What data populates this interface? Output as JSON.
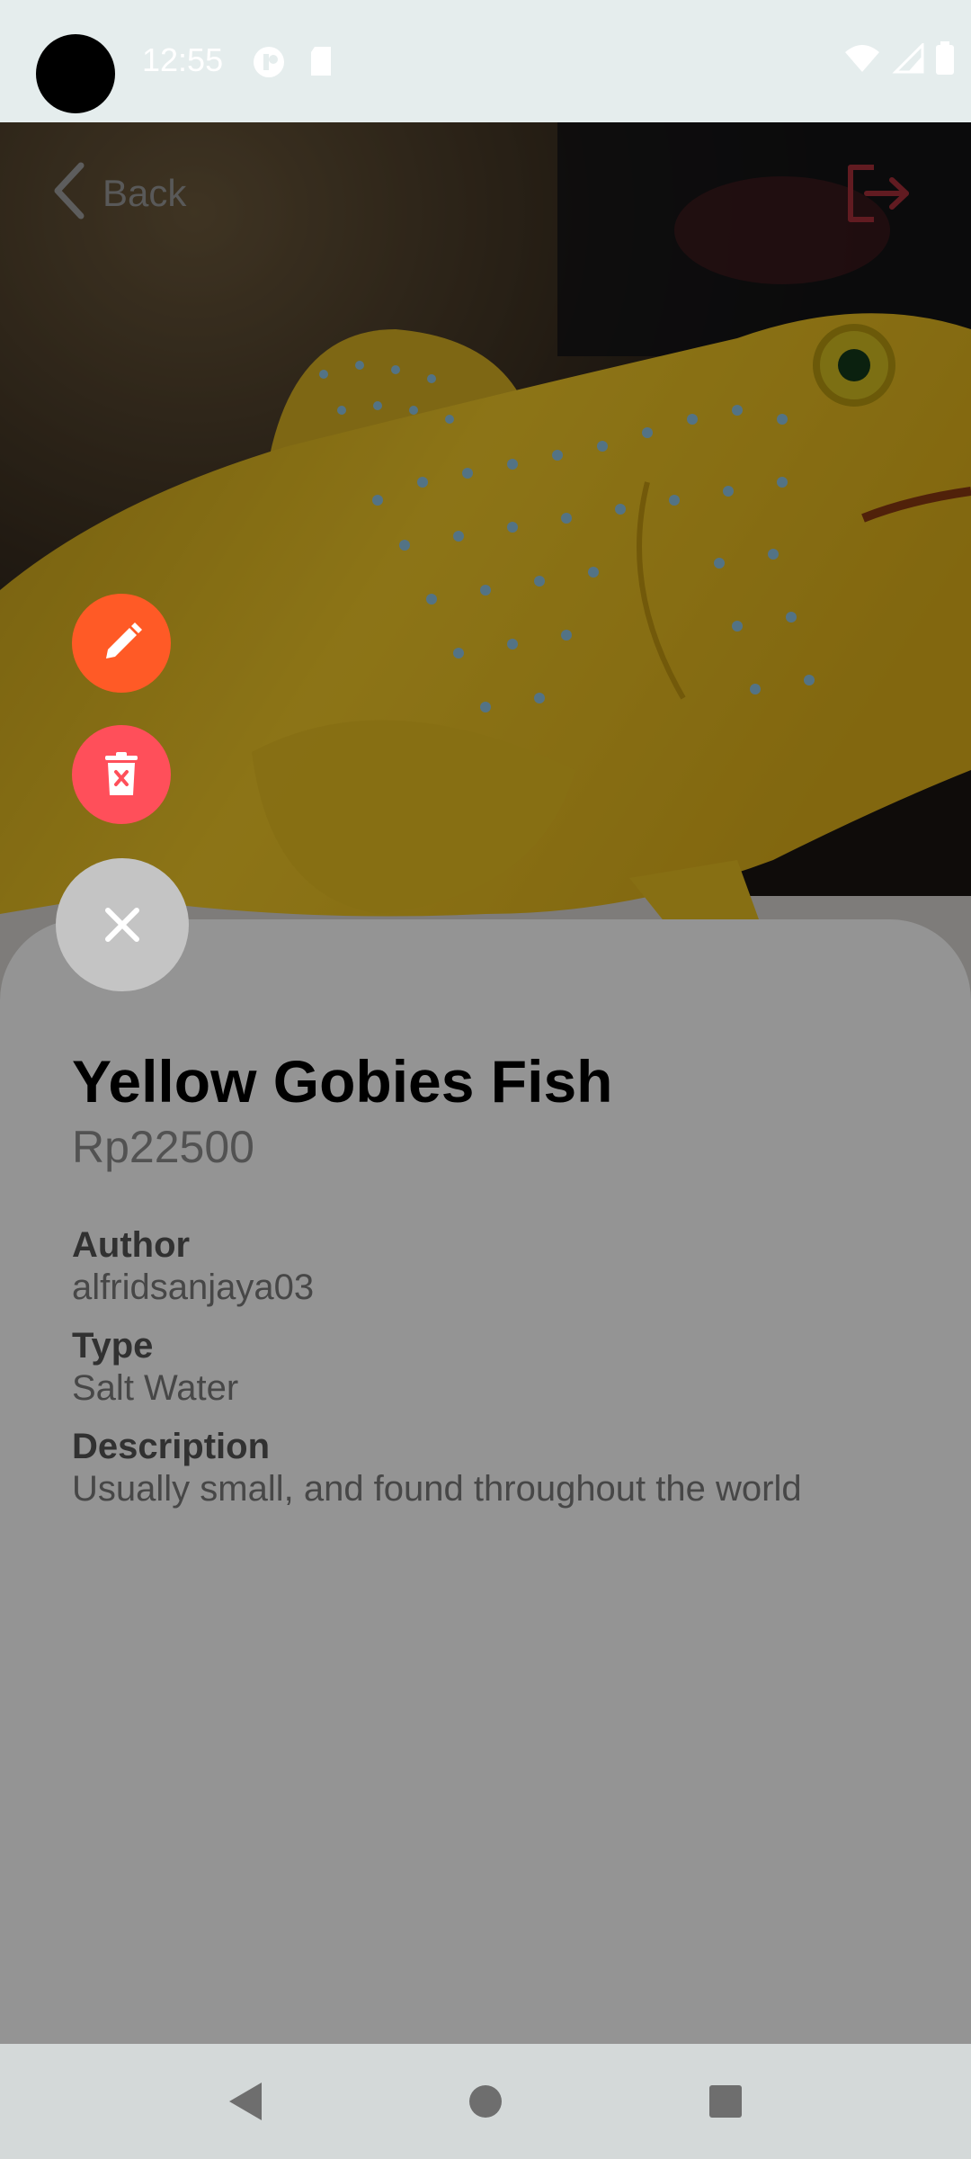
{
  "status_bar": {
    "time": "12:55",
    "icons_left": [
      "media-icon",
      "sd-card-icon"
    ],
    "icons_right": [
      "wifi-icon",
      "signal-icon",
      "battery-icon"
    ]
  },
  "header": {
    "back_label": "Back",
    "back_icon": "chevron-left-icon",
    "logout_icon": "logout-icon",
    "logout_color": "#a8303a"
  },
  "product": {
    "name": "Yellow Gobies Fish",
    "price": "Rp22500",
    "author_label": "Author",
    "author": "alfridsanjaya03",
    "type_label": "Type",
    "type": "Salt Water",
    "description_label": "Description",
    "description": "Usually small, and found throughout the world"
  },
  "fab_menu": {
    "edit_icon": "pencil-icon",
    "edit_color": "#ff5a26",
    "delete_icon": "trash-icon",
    "delete_color": "#ff4f5a",
    "close_icon": "close-icon"
  },
  "nav_bar": {
    "buttons": [
      "back-triangle-icon",
      "home-circle-icon",
      "recents-square-icon"
    ]
  }
}
